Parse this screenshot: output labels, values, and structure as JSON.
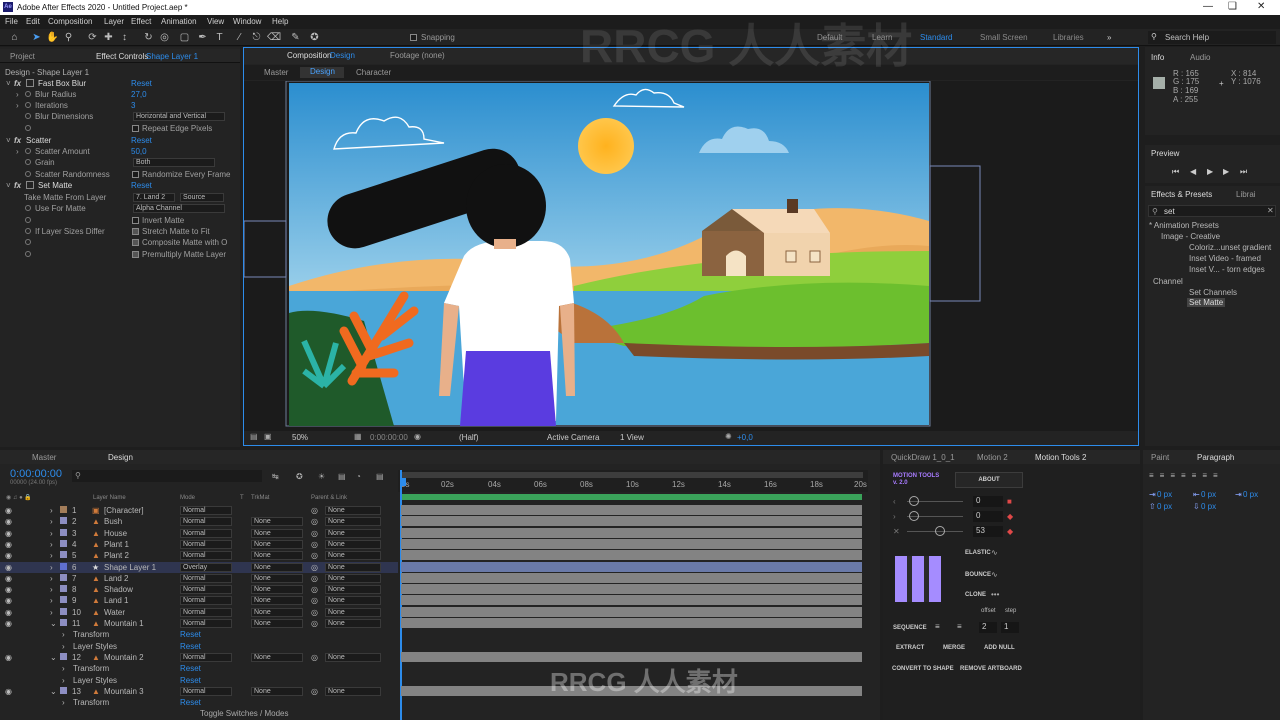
{
  "app": {
    "title": "Adobe After Effects 2020 - Untitled Project.aep *",
    "icon": "Ae"
  },
  "menu": [
    "File",
    "Edit",
    "Composition",
    "Layer",
    "Effect",
    "Animation",
    "View",
    "Window",
    "Help"
  ],
  "toolbar": {
    "snapping": "Snapping",
    "search_help": "Search Help",
    "workspaces": [
      "Default",
      "Learn",
      "Standard",
      "Small Screen",
      "Libraries"
    ],
    "active_workspace": "Standard"
  },
  "project_panel": {
    "tabs": [
      "Project",
      "Effect Controls"
    ],
    "ec_layer": "Shape Layer 1",
    "breadcrumb": "Design - Shape Layer 1",
    "effects": [
      {
        "name": "Fast Box Blur",
        "reset": "Reset"
      },
      {
        "name": "Scatter",
        "reset": "Reset"
      },
      {
        "name": "Set Matte",
        "reset": "Reset"
      }
    ],
    "props": {
      "blur_radius": [
        "Blur Radius",
        "27,0"
      ],
      "iterations": [
        "Iterations",
        "3"
      ],
      "blur_dim": [
        "Blur Dimensions",
        "Horizontal and Vertical"
      ],
      "repeat_edge": "Repeat Edge Pixels",
      "scatter_amount": [
        "Scatter Amount",
        "50,0"
      ],
      "grain": [
        "Grain",
        "Both"
      ],
      "scatter_random": [
        "Scatter Randomness",
        "Randomize Every Frame"
      ],
      "take_matte": [
        "Take Matte From Layer",
        "7. Land 2",
        "Source"
      ],
      "use_for_matte": [
        "Use For Matte",
        "Alpha Channel"
      ],
      "invert_matte": "Invert Matte",
      "if_sizes": "If Layer Sizes Differ",
      "stretch": "Stretch Matte to Fit",
      "composite": "Composite Matte with O",
      "premultiply": "Premultiply Matte Layer"
    }
  },
  "comp_panel": {
    "tab": "Composition",
    "comp_name": "Design",
    "footage": "Footage (none)",
    "flow": [
      "Master",
      "Design",
      "Character"
    ],
    "footer": {
      "zoom": "50%",
      "timecode": "0:00:00:00",
      "quality": "(Half)",
      "camera": "Active Camera",
      "view": "1 View",
      "exposure": "+0,0"
    }
  },
  "info_panel": {
    "tabs": [
      "Info",
      "Audio"
    ],
    "r": "R : 165",
    "g": "G : 175",
    "b": "B : 169",
    "a": "A : 255",
    "x": "X : 814",
    "y": "Y : 1076"
  },
  "preview_panel": {
    "title": "Preview"
  },
  "effects_presets": {
    "tabs": [
      "Effects & Presets",
      "Librai"
    ],
    "search": "set",
    "tree": [
      {
        "label": "* Animation Presets",
        "indent": 0
      },
      {
        "label": "Image - Creative",
        "indent": 1
      },
      {
        "label": "Coloriz...unset gradient",
        "indent": 2
      },
      {
        "label": "Inset Video - framed",
        "indent": 2
      },
      {
        "label": "Inset V... - torn edges",
        "indent": 2
      },
      {
        "label": "Channel",
        "indent": 0
      },
      {
        "label": "Set Channels",
        "indent": 2
      },
      {
        "label": "Set Matte",
        "indent": 2
      }
    ]
  },
  "timeline": {
    "tabs": [
      "Master",
      "Design"
    ],
    "timecode": "0:00:00:00",
    "fps": "00000 (24.00 fps)",
    "headers": [
      "Layer Name",
      "Mode",
      "T",
      "TrkMat",
      "Parent & Link"
    ],
    "ruler": [
      "0s",
      "02s",
      "04s",
      "06s",
      "08s",
      "10s",
      "12s",
      "14s",
      "16s",
      "18s",
      "20s"
    ],
    "layers": [
      {
        "n": "1",
        "name": "[Character]",
        "mode": "Normal",
        "trk": "",
        "parent": "None",
        "color": "#a37d5a",
        "type": "comp"
      },
      {
        "n": "2",
        "name": "Bush",
        "mode": "Normal",
        "trk": "None",
        "parent": "None",
        "color": "#8d8ec2",
        "type": "ai"
      },
      {
        "n": "3",
        "name": "House",
        "mode": "Normal",
        "trk": "None",
        "parent": "None",
        "color": "#8d8ec2",
        "type": "ai"
      },
      {
        "n": "4",
        "name": "Plant 1",
        "mode": "Normal",
        "trk": "None",
        "parent": "None",
        "color": "#8d8ec2",
        "type": "ai"
      },
      {
        "n": "5",
        "name": "Plant 2",
        "mode": "Normal",
        "trk": "None",
        "parent": "None",
        "color": "#8d8ec2",
        "type": "ai"
      },
      {
        "n": "6",
        "name": "Shape Layer 1",
        "mode": "Overlay",
        "trk": "None",
        "parent": "None",
        "color": "#5f6fcf",
        "type": "shape"
      },
      {
        "n": "7",
        "name": "Land 2",
        "mode": "Normal",
        "trk": "None",
        "parent": "None",
        "color": "#8d8ec2",
        "type": "ai"
      },
      {
        "n": "8",
        "name": "Shadow",
        "mode": "Normal",
        "trk": "None",
        "parent": "None",
        "color": "#8d8ec2",
        "type": "ai"
      },
      {
        "n": "9",
        "name": "Land 1",
        "mode": "Normal",
        "trk": "None",
        "parent": "None",
        "color": "#8d8ec2",
        "type": "ai"
      },
      {
        "n": "10",
        "name": "Water",
        "mode": "Normal",
        "trk": "None",
        "parent": "None",
        "color": "#8d8ec2",
        "type": "ai"
      },
      {
        "n": "11",
        "name": "Mountain 1",
        "mode": "Normal",
        "trk": "None",
        "parent": "None",
        "color": "#8d8ec2",
        "type": "ai"
      }
    ],
    "sub": {
      "transform": "Transform",
      "layer_styles": "Layer Styles",
      "reset": "Reset"
    },
    "layers2": [
      {
        "n": "12",
        "name": "Mountain 2",
        "mode": "Normal",
        "trk": "None",
        "parent": "None"
      },
      {
        "n": "13",
        "name": "Mountain 3",
        "mode": "Normal",
        "trk": "None",
        "parent": "None"
      }
    ],
    "toggle": "Toggle Switches / Modes"
  },
  "motion_tools": {
    "tabs": [
      "QuickDraw 1_0_1",
      "Motion 2",
      "Motion Tools 2"
    ],
    "logo": "MOTION TOOLS v. 2.0",
    "about": "ABOUT",
    "values": [
      "0",
      "0",
      "53"
    ],
    "elastic": "ELASTIC",
    "bounce": "BOUNCE",
    "clone": "CLONE",
    "offset": "offset",
    "step": "step",
    "sequence": "SEQUENCE",
    "seq_vals": [
      "2",
      "1"
    ],
    "extract": "EXTRACT",
    "merge": "MERGE",
    "add_null": "ADD NULL",
    "convert": "CONVERT TO SHAPE",
    "remove": "REMOVE ARTBOARD"
  },
  "paragraph": {
    "tabs": [
      "Paint",
      "Paragraph"
    ],
    "px": [
      "0 px",
      "0 px",
      "0 px",
      "0 px",
      "0 px"
    ]
  },
  "watermark": "RRCG 人人素材"
}
